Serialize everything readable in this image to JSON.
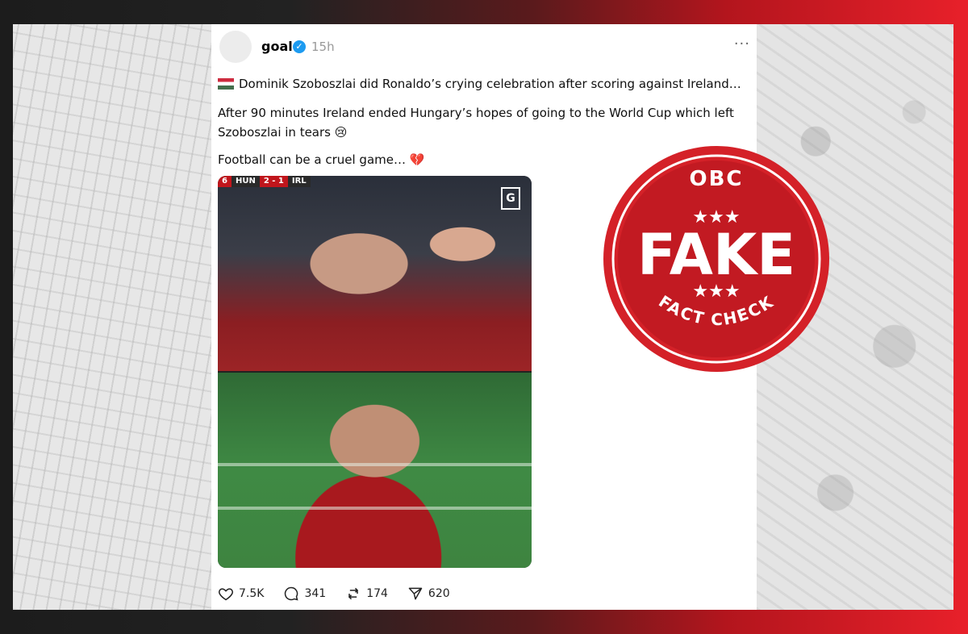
{
  "post": {
    "username": "goal",
    "timestamp": "15h",
    "more": "···",
    "line1": "Dominik Szoboszlai did Ronaldo’s crying celebration after scoring against Ireland…",
    "line2": "After 90 minutes Ireland ended Hungary’s hopes of going to the World Cup which left Szoboszlai in tears 😢",
    "line3": "Football can be a cruel game… 💔",
    "scoreboard": {
      "minute": "6",
      "home": "HUN",
      "score": "2 - 1",
      "away": "IRL"
    },
    "broadcaster_logo": "G",
    "actions": {
      "likes": "7.5K",
      "replies": "341",
      "reposts": "174",
      "shares": "620"
    }
  },
  "stamp": {
    "brand": "OBC",
    "word": "FAKE",
    "subtitle": "FACT CHECK"
  },
  "colors": {
    "stamp_red": "#d42128",
    "accent_red": "#e8202a"
  },
  "icons": [
    "verified-icon",
    "hungary-flag-icon",
    "heart-icon",
    "reply-icon",
    "repost-icon",
    "share-icon",
    "more-icon"
  ]
}
